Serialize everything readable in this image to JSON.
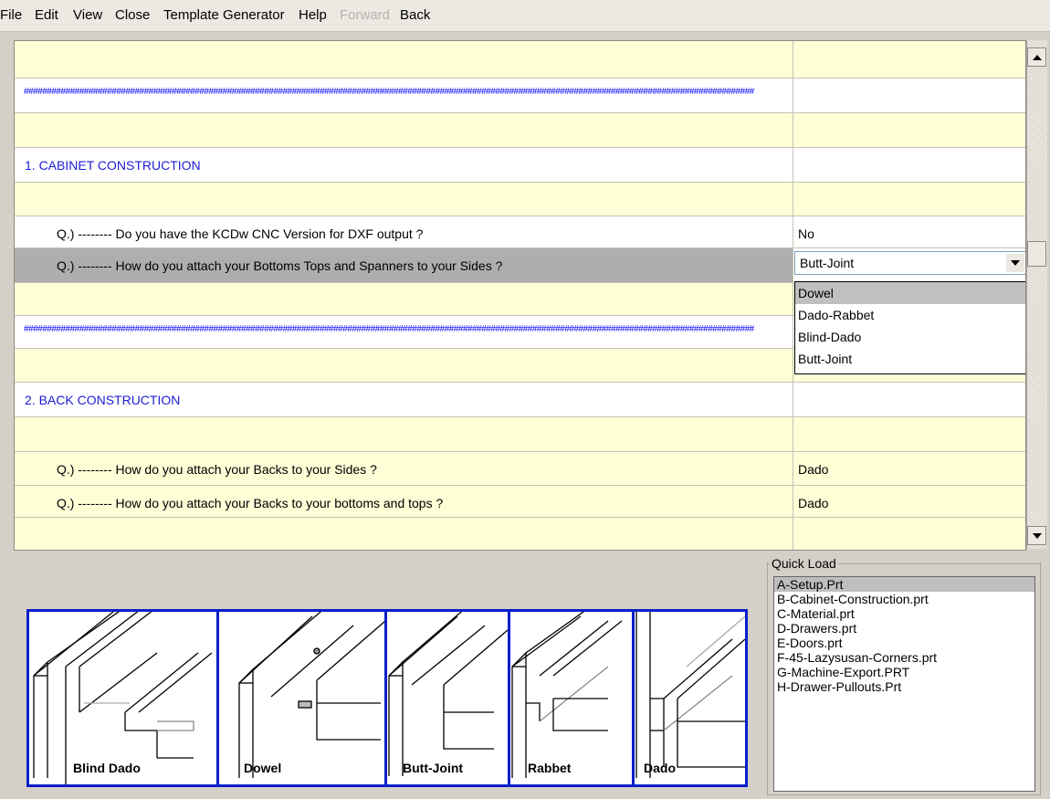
{
  "menu": {
    "file": "File",
    "edit": "Edit",
    "view": "View",
    "close": "Close",
    "template_generator": "Template Generator",
    "help": "Help",
    "forward": "Forward",
    "back": "Back"
  },
  "grid": {
    "hash_text": "##############################################################################################################################################################",
    "section1": "1.  CABINET CONSTRUCTION",
    "q1": "Q.) --------   Do you have the KCDw CNC Version for DXF output ?",
    "a1": "No",
    "q2": "Q.) --------   How do you attach your Bottoms Tops and Spanners to your Sides ?",
    "section2": "2.  BACK CONSTRUCTION",
    "q3": "Q.) --------   How do you attach your Backs to your Sides ?",
    "a3": "Dado",
    "q4": "Q.) --------   How do you attach your Backs to your bottoms and tops ?",
    "a4": "Dado"
  },
  "combo": {
    "value": "Butt-Joint",
    "options": [
      "Dowel",
      "Dado-Rabbet",
      "Blind-Dado",
      "Butt-Joint"
    ],
    "highlighted": "Dowel"
  },
  "quick_load": {
    "label": "Quick Load",
    "items": [
      "A-Setup.Prt",
      "B-Cabinet-Construction.prt",
      "C-Material.prt",
      "D-Drawers.prt",
      "E-Doors.prt",
      "F-45-Lazysusan-Corners.prt",
      "G-Machine-Export.PRT",
      "H-Drawer-Pullouts.Prt"
    ],
    "selected": "A-Setup.Prt"
  },
  "images": {
    "blind_dado": "Blind Dado",
    "dowel": "Dowel",
    "butt_joint": "Butt-Joint",
    "rabbet": "Rabbet",
    "dado": "Dado"
  },
  "colors": {
    "row_yellow": "#fefed7",
    "selected_row": "#aeaeae",
    "section_text": "#1c1cd6",
    "hash_text": "#0000ff",
    "image_border": "#0a1ec8"
  }
}
